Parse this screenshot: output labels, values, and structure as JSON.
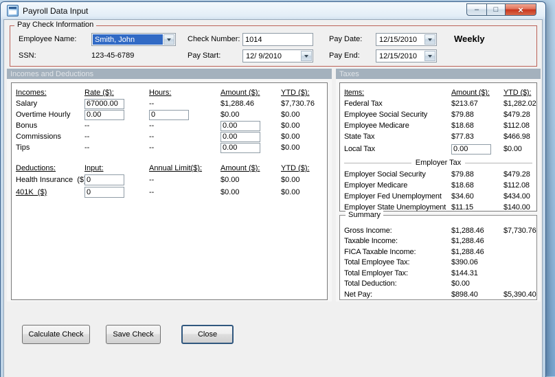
{
  "window": {
    "title": "Payroll Data Input",
    "icons": {
      "minimize": "–",
      "maximize": "□",
      "close": "×"
    }
  },
  "paycheck": {
    "group_title": "Pay Check Information",
    "employee_name_label": "Employee Name:",
    "employee_name_value": "Smith, John",
    "ssn_label": "SSN:",
    "ssn_value": "123-45-6789",
    "check_number_label": "Check Number:",
    "check_number_value": "1014",
    "pay_start_label": "Pay Start:",
    "pay_start_value": "12/ 9/2010",
    "pay_date_label": "Pay Date:",
    "pay_date_value": "12/15/2010",
    "pay_end_label": "Pay End:",
    "pay_end_value": "12/15/2010",
    "frequency": "Weekly"
  },
  "incomes": {
    "band_title": "Incomes and Deductions",
    "headers": {
      "incomes": "Incomes:",
      "rate": "Rate ($):",
      "hours": "Hours:",
      "amount": "Amount ($):",
      "ytd": "YTD ($):"
    },
    "rows": [
      {
        "label": "Salary",
        "rate": "67000.00",
        "hours": "--",
        "amount": "$1,288.46",
        "ytd": "$7,730.76"
      },
      {
        "label": "Overtime Hourly",
        "rate": "0.00",
        "hours": "0",
        "amount": "$0.00",
        "ytd": "$0.00"
      },
      {
        "label": "Bonus",
        "rate": "--",
        "hours": "--",
        "amount": "0.00",
        "ytd": "$0.00"
      },
      {
        "label": "Commissions",
        "rate": "--",
        "hours": "--",
        "amount": "0.00",
        "ytd": "$0.00"
      },
      {
        "label": "Tips",
        "rate": "--",
        "hours": "--",
        "amount": "0.00",
        "ytd": "$0.00"
      }
    ],
    "deduction_headers": {
      "deductions": "Deductions:",
      "input": "Input:",
      "limit": "Annual Limit($):",
      "amount": "Amount ($):",
      "ytd": "YTD ($):"
    },
    "deduction_rows": [
      {
        "label": "Health Insurance  ($)",
        "input": "0",
        "limit": "--",
        "amount": "$0.00",
        "ytd": "$0.00"
      },
      {
        "label": "401K  ($)",
        "input": "0",
        "limit": "--",
        "amount": "$0.00",
        "ytd": "$0.00"
      }
    ]
  },
  "taxes": {
    "band_title": "Taxes",
    "headers": {
      "items": "Items:",
      "amount": "Amount ($):",
      "ytd": "YTD ($):"
    },
    "rows": [
      {
        "label": "Federal Tax",
        "amount": "$213.67",
        "ytd": "$1,282.02"
      },
      {
        "label": "Employee Social Security",
        "amount": "$79.88",
        "ytd": "$479.28"
      },
      {
        "label": "Employee Medicare",
        "amount": "$18.68",
        "ytd": "$112.08"
      },
      {
        "label": "State Tax",
        "amount": "$77.83",
        "ytd": "$466.98"
      }
    ],
    "local_tax": {
      "label": "Local Tax",
      "amount": "0.00",
      "ytd": "$0.00"
    },
    "employer_header": "Employer Tax",
    "employer_rows": [
      {
        "label": "Employer Social Security",
        "amount": "$79.88",
        "ytd": "$479.28"
      },
      {
        "label": "Employer Medicare",
        "amount": "$18.68",
        "ytd": "$112.08"
      },
      {
        "label": "Employer Fed Unemployment",
        "amount": "$34.60",
        "ytd": "$434.00"
      },
      {
        "label": "Employer State Unemployment",
        "amount": "$11.15",
        "ytd": "$140.00"
      }
    ]
  },
  "summary": {
    "title": "Summary",
    "rows": [
      {
        "label": "Gross Income:",
        "amount": "$1,288.46",
        "ytd": "$7,730.76"
      },
      {
        "label": "Taxable Income:",
        "amount": "$1,288.46",
        "ytd": ""
      },
      {
        "label": "FICA Taxable Income:",
        "amount": "$1,288.46",
        "ytd": ""
      },
      {
        "label": "Total Employee Tax:",
        "amount": "$390.06",
        "ytd": ""
      },
      {
        "label": "Total Employer Tax:",
        "amount": "$144.31",
        "ytd": ""
      },
      {
        "label": "Total Deduction:",
        "amount": "$0.00",
        "ytd": ""
      },
      {
        "label": "Net Pay:",
        "amount": "$898.40",
        "ytd": "$5,390.40"
      }
    ]
  },
  "buttons": {
    "calculate": "Calculate Check",
    "save": "Save Check",
    "close": "Close"
  },
  "colors": {
    "selection_blue": "#316ac5",
    "section_band": "#a4b1bd",
    "group_border_red": "#bb6157",
    "close_button_red": "#c8351c",
    "desktop_blue": "#a9cbe6"
  }
}
